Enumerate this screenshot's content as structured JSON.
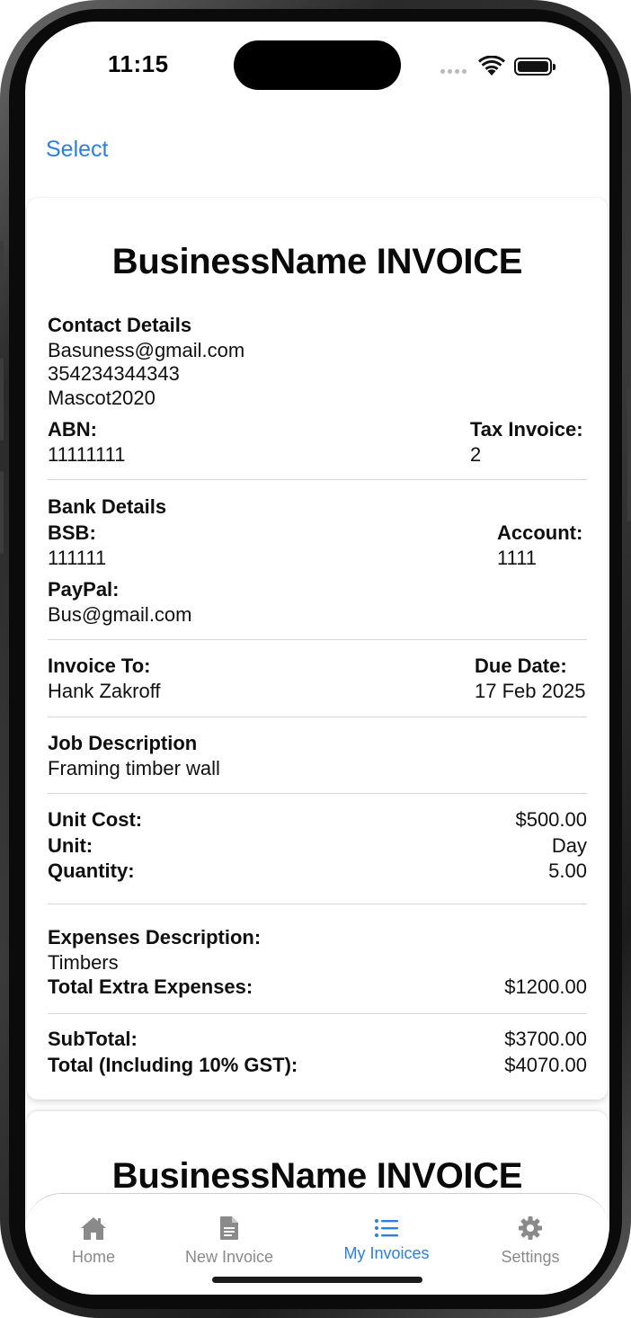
{
  "status": {
    "time": "11:15"
  },
  "nav": {
    "select_label": "Select"
  },
  "invoice": {
    "title": "BusinessName INVOICE",
    "contact_heading": "Contact Details",
    "contact_email": "Basuness@gmail.com",
    "contact_phone": "354234344343",
    "contact_address": "Mascot2020",
    "abn_label": "ABN:",
    "abn_value": "11111111",
    "tax_invoice_label": "Tax Invoice:",
    "tax_invoice_value": "2",
    "bank_heading": "Bank Details",
    "bsb_label": "BSB:",
    "bsb_value": "111111",
    "account_label": "Account:",
    "account_value": "1111",
    "paypal_label": "PayPal:",
    "paypal_value": "Bus@gmail.com",
    "invoice_to_label": "Invoice To:",
    "invoice_to_value": "Hank Zakroff",
    "due_date_label": "Due Date:",
    "due_date_value": "17 Feb 2025",
    "job_heading": "Job Description",
    "job_value": "Framing timber wall",
    "unit_cost_label": "Unit Cost:",
    "unit_cost_value": "$500.00",
    "unit_label": "Unit:",
    "unit_value": "Day",
    "quantity_label": "Quantity:",
    "quantity_value": "5.00",
    "expenses_desc_label": "Expenses Description:",
    "expenses_desc_value": "Timbers",
    "extra_expenses_label": "Total Extra Expenses:",
    "extra_expenses_value": "$1200.00",
    "subtotal_label": "SubTotal:",
    "subtotal_value": "$3700.00",
    "total_label": "Total (Including 10% GST):",
    "total_value": "$4070.00"
  },
  "next_invoice": {
    "title": "BusinessName INVOICE"
  },
  "tabbar": {
    "home": {
      "label": "Home",
      "icon": "house-icon"
    },
    "new_invoice": {
      "label": "New Invoice",
      "icon": "document-icon"
    },
    "my_invoices": {
      "label": "My Invoices",
      "icon": "list-icon"
    },
    "settings": {
      "label": "Settings",
      "icon": "gear-icon"
    }
  },
  "colors": {
    "accent": "#2b7fe3",
    "inactive_tab": "#8a8a8a",
    "divider": "#d6d6d6"
  }
}
